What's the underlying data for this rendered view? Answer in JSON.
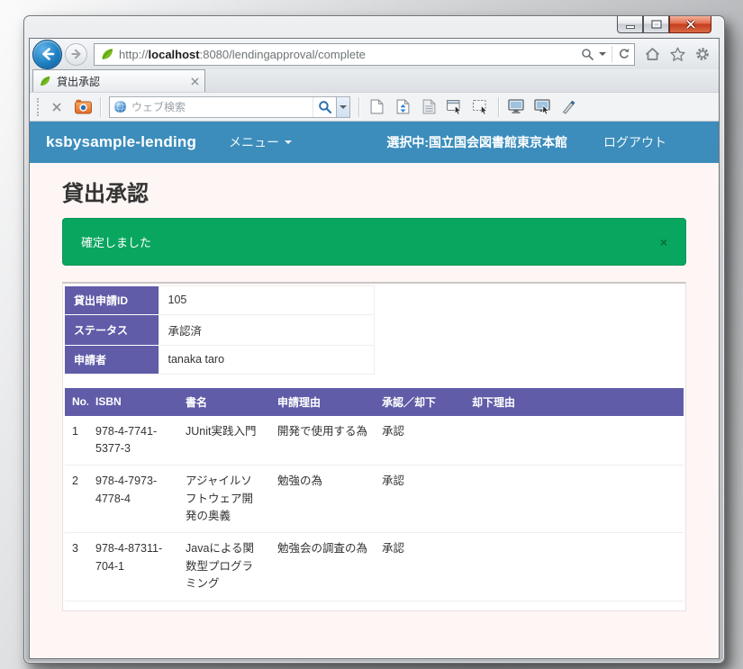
{
  "browser": {
    "url": {
      "prefix": "http://",
      "host": "localhost",
      "path": ":8080/lendingapproval/complete"
    },
    "tab": {
      "title": "貸出承認"
    },
    "search": {
      "placeholder": "ウェブ検索"
    }
  },
  "navbar": {
    "brand": "ksbysample-lending",
    "menu_label": "メニュー",
    "selected_label": "選択中:国立国会図書館東京本館",
    "logout_label": "ログアウト"
  },
  "page": {
    "title": "貸出承認"
  },
  "alert": {
    "message": "確定しました",
    "close": "×"
  },
  "info_table": {
    "rows": [
      {
        "label": "貸出申請ID",
        "value": "105"
      },
      {
        "label": "ステータス",
        "value": "承認済"
      },
      {
        "label": "申請者",
        "value": "tanaka taro"
      }
    ]
  },
  "approval_table": {
    "headers": [
      "No.",
      "ISBN",
      "書名",
      "申請理由",
      "承認／却下",
      "却下理由"
    ],
    "rows": [
      [
        "1",
        "978-4-7741-5377-3",
        "JUnit実践入門",
        "開発で使用する為",
        "承認",
        ""
      ],
      [
        "2",
        "978-4-7973-4778-4",
        "アジャイルソフトウェア開発の奥義",
        "勉強の為",
        "承認",
        ""
      ],
      [
        "3",
        "978-4-87311-704-1",
        "Javaによる関数型プログラミング",
        "勉強会の調査の為",
        "承認",
        ""
      ]
    ]
  },
  "colors": {
    "navbar_blue": "#3c8dbc",
    "table_header_purple": "#605ca8",
    "alert_success_green": "#09a65f",
    "page_background": "#fdf6f4",
    "close_button_red": "#c43d1e"
  }
}
